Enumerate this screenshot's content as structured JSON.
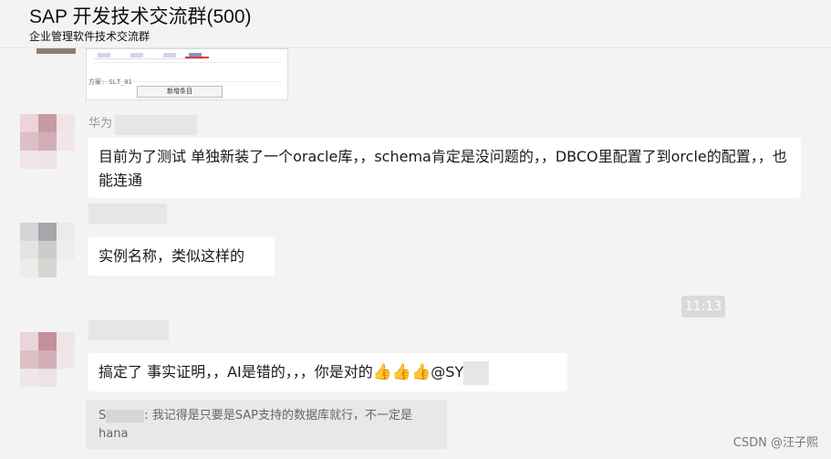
{
  "header": {
    "title": "SAP 开发技术交流群(500)",
    "subtitle": "企业管理软件技术交流群"
  },
  "thumbnail": {
    "caption": "方案: SLT_01",
    "button": "新增条目"
  },
  "messages": [
    {
      "sender_visible": "华为",
      "text": "目前为了测试 单独新装了一个oracle库，，schema肯定是没问题的，，DBCO里配置了到orcle的配置，，也能连通"
    },
    {
      "sender_visible": "",
      "text": "实例名称，类似这样的"
    },
    {
      "sender_visible": "",
      "text_before": "搞定了  事实证明，，AI是错的，，，你是对的",
      "emoji": "👍👍👍",
      "mention": "@SY"
    }
  ],
  "time_divider": "11:13",
  "quote": {
    "sender_prefix": "S",
    "text": ": 我记得是只要是SAP支持的数据库就行，不一定是hana"
  },
  "watermark": "CSDN @汪子熙",
  "icons": [
    "thumbs-up-icon"
  ]
}
